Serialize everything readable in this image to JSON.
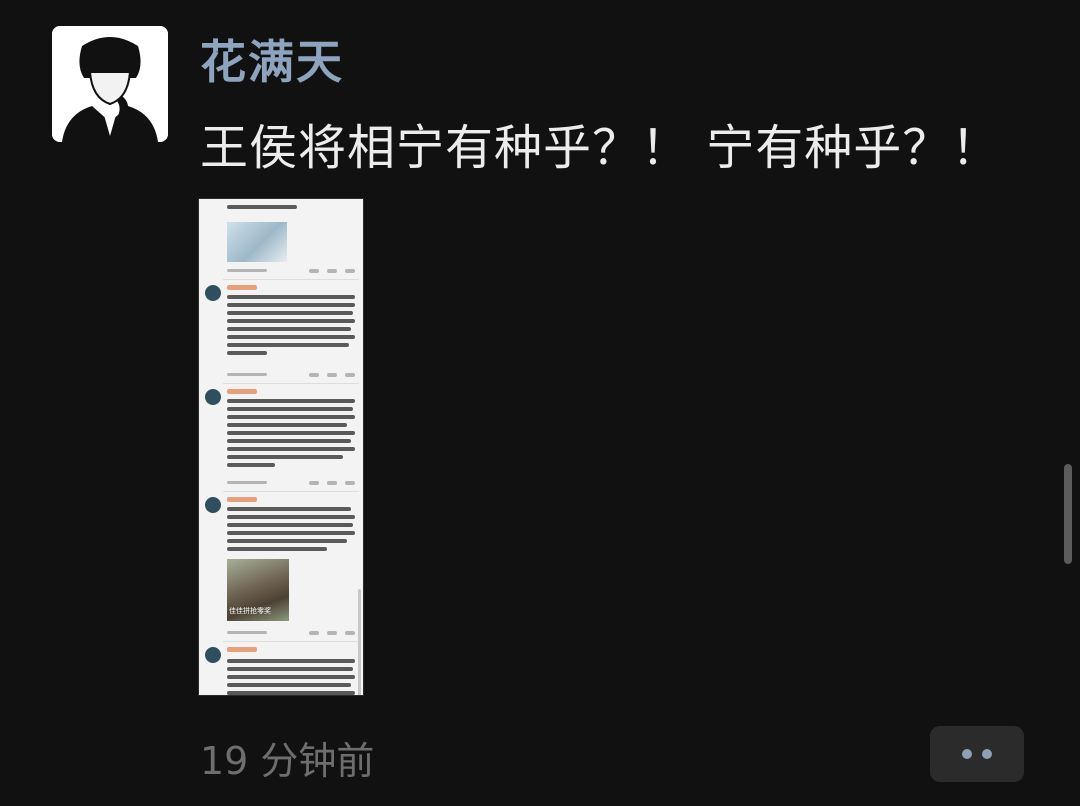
{
  "post": {
    "author": "花满天",
    "text": "王侯将相宁有种乎？！ 宁有种乎？！",
    "timestamp": "19 分钟前"
  },
  "image": {
    "caption": "佳佳拼抢零奖",
    "comments": [
      {
        "author": "花西子Florasis"
      },
      {
        "author": "花西子Florasis"
      },
      {
        "author": "花西子Florasis"
      },
      {
        "author": "花西子Florasis"
      }
    ]
  },
  "colors": {
    "background": "#111111",
    "author": "#8ea3bd",
    "text": "#ececec",
    "timestamp": "#6e6e6e"
  },
  "icons": {
    "more": "more-dots-icon"
  }
}
